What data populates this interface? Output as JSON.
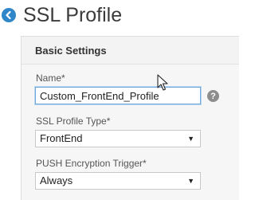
{
  "page": {
    "title": "SSL Profile",
    "back_icon": "back-arrow-circle-icon"
  },
  "panel": {
    "header": "Basic Settings"
  },
  "form": {
    "name": {
      "label": "Name*",
      "value": "Custom_FrontEnd_Profile",
      "help_icon": "question-circle-icon",
      "help_glyph": "?"
    },
    "ssl_profile_type": {
      "label": "SSL Profile Type*",
      "selected": "FrontEnd",
      "caret": "▼"
    },
    "push_encryption_trigger": {
      "label": "PUSH Encryption Trigger*",
      "selected": "Always",
      "caret": "▼"
    }
  },
  "colors": {
    "accent": "#2f86c9",
    "focus_border": "#6fa8dc"
  }
}
